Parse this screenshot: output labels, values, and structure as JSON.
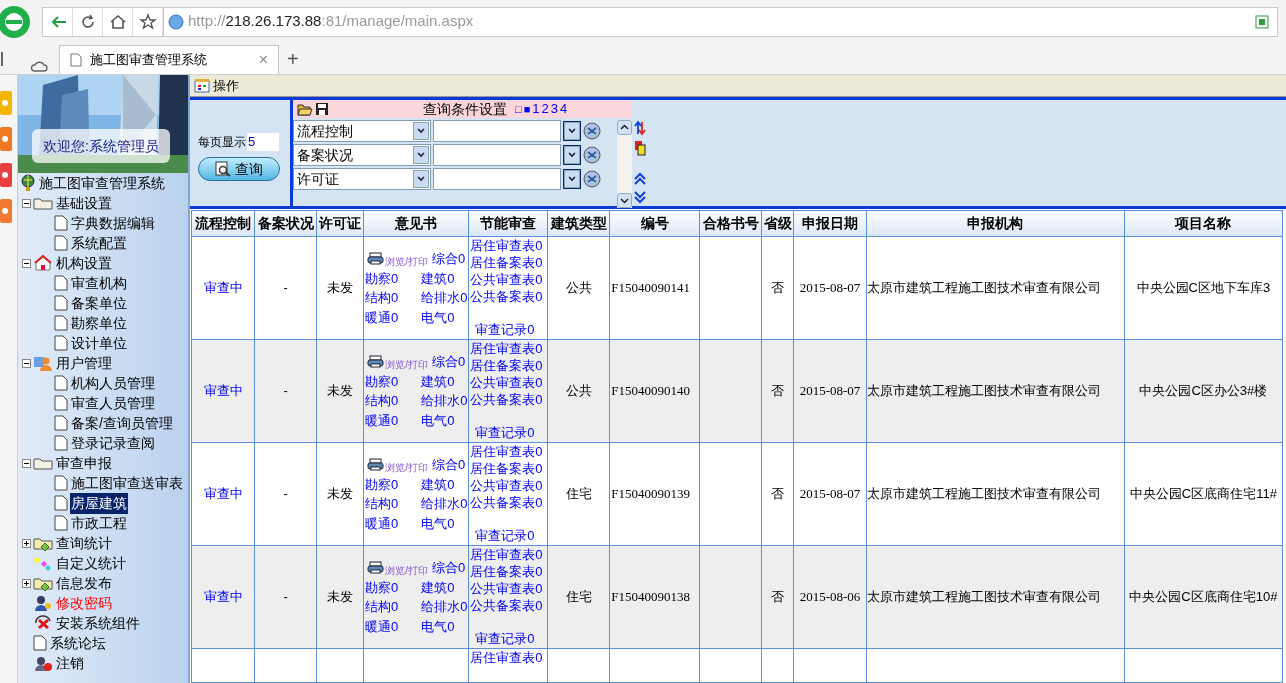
{
  "browser": {
    "url_scheme": "http://",
    "url_host": "218.26.173.88",
    "url_rest": ":81/manage/main.aspx",
    "tab_title": "施工图审查管理系统",
    "close": "×",
    "new_tab": "+"
  },
  "banner": {
    "welcome": "欢迎您:系统管理员"
  },
  "tree": [
    {
      "label": "施工图审查管理系统",
      "kind": "globe",
      "selected": false,
      "children": [
        {
          "label": "基础设置",
          "kind": "folder",
          "selected": false,
          "expanded": true,
          "children": [
            {
              "label": "字典数据编辑",
              "kind": "page",
              "selected": false
            },
            {
              "label": "系统配置",
              "kind": "page",
              "selected": false
            }
          ]
        },
        {
          "label": "机构设置",
          "kind": "house",
          "selected": false,
          "expanded": true,
          "children": [
            {
              "label": "审查机构",
              "kind": "page",
              "selected": false
            },
            {
              "label": "备案单位",
              "kind": "page",
              "selected": false
            },
            {
              "label": "勘察单位",
              "kind": "page",
              "selected": false
            },
            {
              "label": "设计单位",
              "kind": "page",
              "selected": false
            }
          ]
        },
        {
          "label": "用户管理",
          "kind": "people",
          "selected": false,
          "expanded": true,
          "children": [
            {
              "label": "机构人员管理",
              "kind": "page",
              "selected": false
            },
            {
              "label": "审查人员管理",
              "kind": "page",
              "selected": false
            },
            {
              "label": "备案/查询员管理",
              "kind": "page",
              "selected": false
            },
            {
              "label": "登录记录查阅",
              "kind": "page",
              "selected": false
            }
          ]
        },
        {
          "label": "审查申报",
          "kind": "folder",
          "selected": false,
          "expanded": true,
          "children": [
            {
              "label": "施工图审查送审表",
              "kind": "page",
              "selected": false
            },
            {
              "label": "房屋建筑",
              "kind": "page",
              "selected": true
            },
            {
              "label": "市政工程",
              "kind": "page",
              "selected": false
            }
          ]
        },
        {
          "label": "查询统计",
          "kind": "stats",
          "selected": false,
          "expanded": false
        },
        {
          "label": "自定义统计",
          "kind": "custom",
          "selected": false
        },
        {
          "label": "信息发布",
          "kind": "stats",
          "selected": false,
          "expanded": false
        },
        {
          "label": "修改密码",
          "kind": "password",
          "selected": false,
          "color": "#ff0000"
        },
        {
          "label": "安装系统组件",
          "kind": "install",
          "selected": false
        },
        {
          "label": "系统论坛",
          "kind": "page",
          "selected": false
        },
        {
          "label": "注销",
          "kind": "logout",
          "selected": false
        }
      ]
    }
  ],
  "toolbar": {
    "label": "操作"
  },
  "query": {
    "page_size_label": "每页显示",
    "page_size": "5",
    "search_button": "查询",
    "title": "查询条件设置",
    "pager_marks": [
      "□",
      "■"
    ],
    "pages": [
      "1",
      "2",
      "3",
      "4"
    ],
    "conditions": [
      {
        "field": "流程控制"
      },
      {
        "field": "备案状况"
      },
      {
        "field": "许可证"
      }
    ]
  },
  "table": {
    "columns": [
      "流程控制",
      "备案状况",
      "许可证",
      "意见书",
      "节能审查",
      "建筑类型",
      "编号",
      "合格书号",
      "省级",
      "申报日期",
      "申报机构",
      "项目名称"
    ],
    "rows": [
      {
        "status": "审查中",
        "filing": "-",
        "permit": "未发",
        "print": "浏览/打印",
        "opinions": [
          "综合0",
          "勘察0",
          "建筑0",
          "结构0",
          "给排水0",
          "暖通0",
          "电气0"
        ],
        "energy": [
          "居住审查表0",
          "居住备案表0",
          "公共审查表0",
          "公共备案表0"
        ],
        "energy_record": "审查记录0",
        "building_type": "公共",
        "number": "F15040090141",
        "provincial": "否",
        "date": "2015-08-07",
        "org": "太原市建筑工程施工图技术审查有限公司",
        "project": "中央公园C区地下车库3"
      },
      {
        "status": "审查中",
        "filing": "-",
        "permit": "未发",
        "print": "浏览/打印",
        "opinions": [
          "综合0",
          "勘察0",
          "建筑0",
          "结构0",
          "给排水0",
          "暖通0",
          "电气0"
        ],
        "energy": [
          "居住审查表0",
          "居住备案表0",
          "公共审查表0",
          "公共备案表0"
        ],
        "energy_record": "审查记录0",
        "building_type": "公共",
        "number": "F15040090140",
        "provincial": "否",
        "date": "2015-08-07",
        "org": "太原市建筑工程施工图技术审查有限公司",
        "project": "中央公园C区办公3#楼"
      },
      {
        "status": "审查中",
        "filing": "-",
        "permit": "未发",
        "print": "浏览/打印",
        "opinions": [
          "综合0",
          "勘察0",
          "建筑0",
          "结构0",
          "给排水0",
          "暖通0",
          "电气0"
        ],
        "energy": [
          "居住审查表0",
          "居住备案表0",
          "公共审查表0",
          "公共备案表0"
        ],
        "energy_record": "审查记录0",
        "building_type": "住宅",
        "number": "F15040090139",
        "provincial": "否",
        "date": "2015-08-07",
        "org": "太原市建筑工程施工图技术审查有限公司",
        "project": "中央公园C区底商住宅11#"
      },
      {
        "status": "审查中",
        "filing": "-",
        "permit": "未发",
        "print": "浏览/打印",
        "opinions": [
          "综合0",
          "勘察0",
          "建筑0",
          "结构0",
          "给排水0",
          "暖通0",
          "电气0"
        ],
        "energy": [
          "居住审查表0",
          "居住备案表0",
          "公共审查表0",
          "公共备案表0"
        ],
        "energy_record": "审查记录0",
        "building_type": "住宅",
        "number": "F15040090138",
        "provincial": "否",
        "date": "2015-08-06",
        "org": "太原市建筑工程施工图技术审查有限公司",
        "project": "中央公园C区底商住宅10#"
      },
      {
        "energy": [
          "居住审查表0"
        ]
      }
    ]
  }
}
